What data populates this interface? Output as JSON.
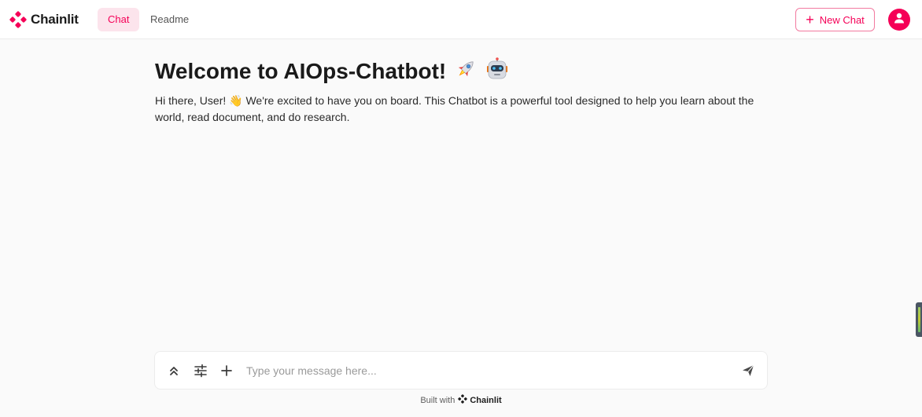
{
  "app": {
    "brand_name": "Chainlit",
    "brand_color": "#f50057"
  },
  "header": {
    "tabs": [
      {
        "label": "Chat",
        "active": true
      },
      {
        "label": "Readme",
        "active": false
      }
    ],
    "new_chat_label": "New Chat",
    "new_chat_icon": "plus-icon",
    "avatar_icon": "user-icon"
  },
  "welcome": {
    "title": "Welcome to AIOps-Chatbot!",
    "title_emojis": [
      "rocket-emoji",
      "robot-emoji"
    ],
    "body": "Hi there, User! 👋 We're excited to have you on board. This Chatbot is a powerful tool designed to help you learn about the world, read document, and do research."
  },
  "composer": {
    "placeholder": "Type your message here...",
    "value": "",
    "icons": [
      "chevrons-up-icon",
      "settings-sliders-icon",
      "plus-icon",
      "send-icon"
    ]
  },
  "footer": {
    "built_with": "Built with",
    "brand": "Chainlit"
  }
}
